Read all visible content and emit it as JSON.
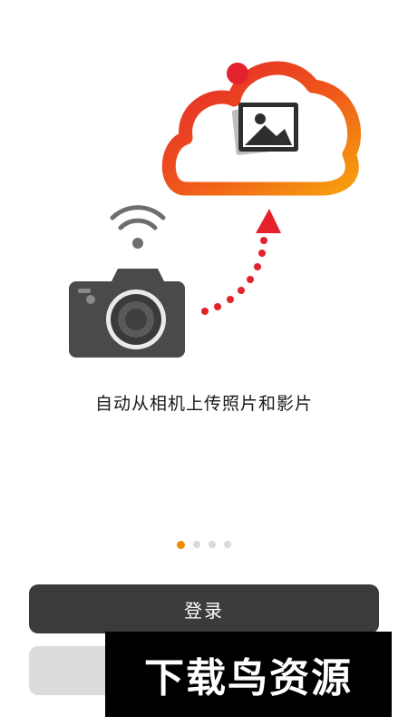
{
  "onboarding": {
    "caption": "自动从相机上传照片和影片",
    "pages": 4,
    "current_page": 1
  },
  "buttons": {
    "login_label": "登录",
    "secondary_label": ""
  },
  "watermark": {
    "text": "下载鸟资源"
  },
  "icons": {
    "cloud": "cloud-upload-icon",
    "photo": "photo-icon",
    "camera": "camera-icon",
    "wifi": "wifi-icon",
    "arrow": "upload-arrow-icon"
  },
  "colors": {
    "accent_orange": "#f08c00",
    "accent_red": "#e3222b",
    "button_dark": "#3b3b3b",
    "button_light": "#dcdcdc",
    "camera_gray": "#4a4a4a"
  }
}
